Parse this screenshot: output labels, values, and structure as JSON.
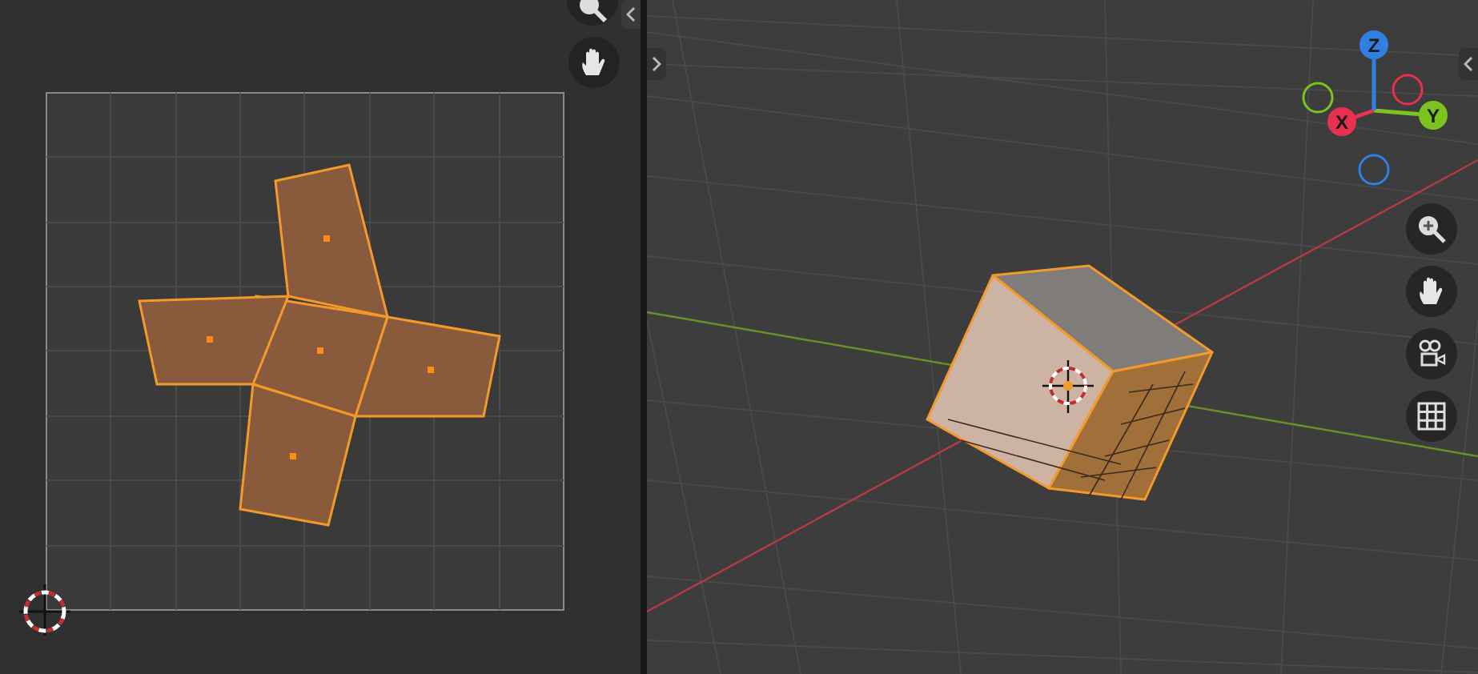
{
  "viewport": {
    "gizmo_axes": [
      {
        "label": "Z",
        "color": "#2f80e0",
        "kind": "positive"
      },
      {
        "label": "X",
        "color": "#e8304f",
        "kind": "positive"
      },
      {
        "label": "Y",
        "color": "#7bc41f",
        "kind": "positive"
      },
      {
        "color": "#7bc41f",
        "kind": "negative"
      },
      {
        "color": "#e8304f",
        "kind": "negative"
      },
      {
        "color": "#2f80e0",
        "kind": "negative"
      }
    ]
  }
}
